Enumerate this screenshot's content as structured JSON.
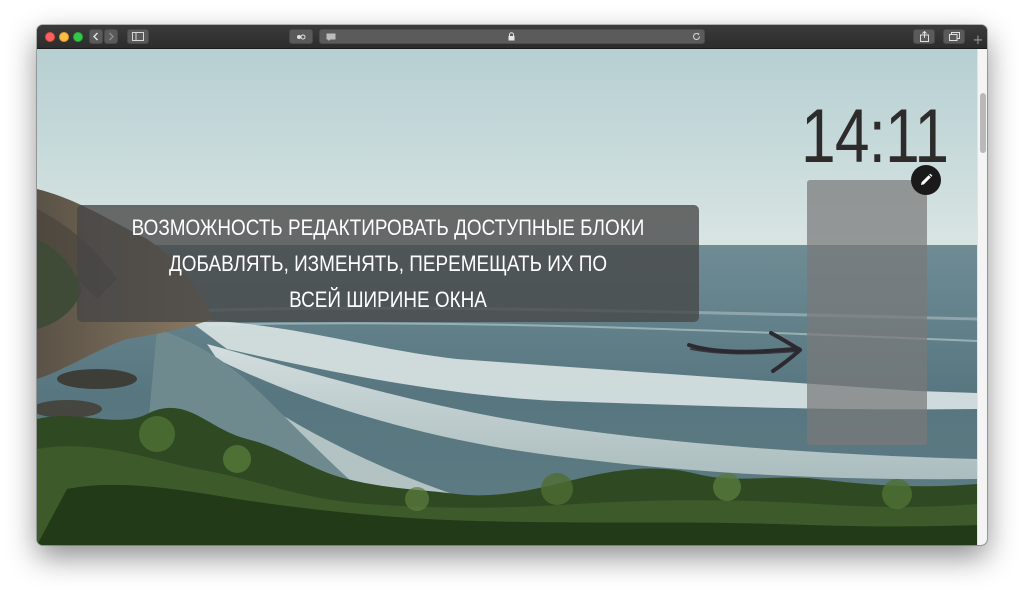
{
  "window": {
    "url_text": "",
    "colors": {
      "close": "#fc605c",
      "minimize": "#fdbc40",
      "zoom": "#34c84a",
      "toolbar": "#343434"
    },
    "icons": [
      "back-chevron-icon",
      "forward-chevron-icon",
      "sidebar-icon",
      "privacy-icon",
      "reader-icon",
      "lock-icon",
      "reload-icon",
      "share-icon",
      "tabs-overview-icon",
      "plus-icon"
    ],
    "new_tab_label": "+"
  },
  "page": {
    "clock_time": "14:11",
    "caption": {
      "line1": "ВОЗМОЖНОСТЬ РЕДАКТИРОВАТЬ ДОСТУПНЫЕ БЛОКИ",
      "line2": "ДОБАВЛЯТЬ, ИЗМЕНЯТЬ, ПЕРЕМЕЩАТЬ ИХ ПО",
      "line3": "ВСЕЙ ШИРИНЕ ОКНА"
    },
    "edit_icon": "pencil-icon",
    "arrow_icon": "hand-drawn-arrow-icon",
    "background": "ocean-coast-photo"
  }
}
